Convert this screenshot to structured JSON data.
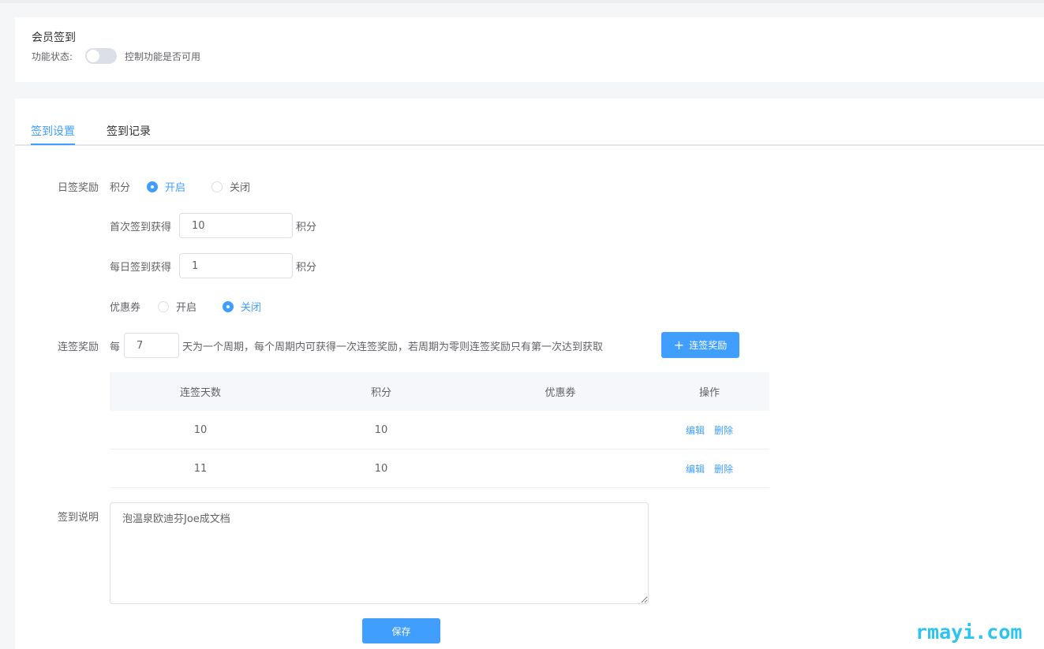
{
  "header": {
    "title": "会员签到",
    "status_label": "功能状态:",
    "switch_desc": "控制功能是否可用",
    "switch_on": false
  },
  "tabs": [
    {
      "label": "签到设置",
      "active": true
    },
    {
      "label": "签到记录",
      "active": false
    }
  ],
  "daily": {
    "label": "日签奖励",
    "points_label": "积分",
    "points_options": [
      "开启",
      "关闭"
    ],
    "points_selected": "开启",
    "first_label": "首次签到获得",
    "first_value": "10",
    "first_unit": "积分",
    "everyday_label": "每日签到获得",
    "everyday_value": "1",
    "everyday_unit": "积分",
    "coupon_label": "优惠券",
    "coupon_options": [
      "开启",
      "关闭"
    ],
    "coupon_selected": "关闭"
  },
  "streak": {
    "label": "连签奖励",
    "prefix": "每",
    "days_value": "7",
    "suffix": "天为一个周期，每个周期内可获得一次连签奖励，若周期为零则连签奖励只有第一次达到获取",
    "add_button": "连签奖励",
    "table": {
      "headers": [
        "连签天数",
        "积分",
        "优惠券",
        "操作"
      ],
      "rows": [
        {
          "days": "10",
          "points": "10",
          "coupon": "",
          "edit": "编辑",
          "delete": "删除"
        },
        {
          "days": "11",
          "points": "10",
          "coupon": "",
          "edit": "编辑",
          "delete": "删除"
        }
      ]
    }
  },
  "description": {
    "label": "签到说明",
    "value": "泡温泉欧迪芬Joe成文档"
  },
  "save_button": "保存",
  "watermark": "rmayi.com",
  "colors": {
    "primary": "#409eff",
    "watermark": "#2ec4f0"
  }
}
